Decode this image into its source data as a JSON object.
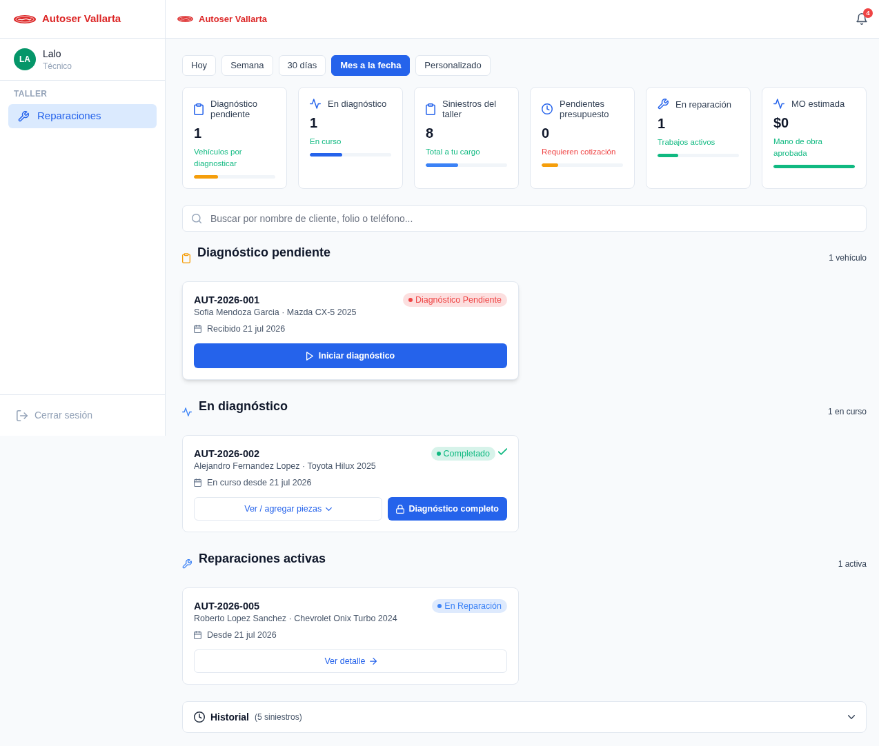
{
  "sidebar": {
    "brand": "Autoser Vallarta",
    "user": {
      "initials": "LA",
      "name": "Lalo",
      "role": "Técnico"
    },
    "sections": [
      {
        "label": "TALLER",
        "items": [
          {
            "label": "Reparaciones",
            "selected": true
          }
        ]
      }
    ],
    "logout": "Cerrar sesión"
  },
  "header": {
    "brand": "Autoser Vallarta",
    "notifications": "4"
  },
  "periods": [
    {
      "label": "Hoy",
      "selected": false
    },
    {
      "label": "Semana",
      "selected": false
    },
    {
      "label": "30 días",
      "selected": false
    },
    {
      "label": "Mes a la fecha",
      "selected": true
    },
    {
      "label": "Personalizado",
      "selected": false
    }
  ],
  "kpis": [
    {
      "kind": "pending",
      "title": "Diagnóstico pendiente",
      "value": "1",
      "note": {
        "text": "Vehículos por diagnosticar",
        "color": "#10b981"
      },
      "bar": {
        "level": 0.3,
        "color": "#f59e0b"
      }
    },
    {
      "kind": "diagnosis",
      "title": "En diagnóstico",
      "value": "1",
      "note": {
        "text": "En curso",
        "color": "#10b981"
      },
      "bar": {
        "level": 0.4,
        "color": "#2563eb"
      }
    },
    {
      "kind": "claims",
      "title": "Siniestros del taller",
      "value": "8",
      "note": {
        "text": "Total a tu cargo",
        "color": "#10b981"
      },
      "bar": {
        "level": 0.4,
        "color": "#3b82f6"
      }
    },
    {
      "kind": "quote",
      "title": "Pendientes presupuesto",
      "value": "0",
      "note": {
        "text": "Requieren cotización",
        "color": "#ef4444"
      },
      "bar": {
        "level": 0.2,
        "color": "#f59e0b"
      }
    },
    {
      "kind": "repair",
      "title": "En reparación",
      "value": "1",
      "note": {
        "text": "Trabajos activos",
        "color": "#10b981"
      },
      "bar": {
        "level": 0.25,
        "color": "#10b981"
      }
    },
    {
      "kind": "labor",
      "title": "MO estimada",
      "value": "$0",
      "note": {
        "text": "Mano de obra aprobada",
        "color": "#10b981"
      },
      "bar": {
        "level": 1,
        "color": "#10b981"
      }
    }
  ],
  "search": {
    "placeholder": "Buscar por nombre de cliente, folio o teléfono..."
  },
  "sections": [
    {
      "kind": "pending",
      "title": "Diagnóstico pendiente",
      "count": "1 vehículo",
      "cards": [
        {
          "folio": "AUT-2026-001",
          "details": "Sofia Mendoza Garcia · Mazda CX-5 2025",
          "date": "Recibido 21 jul 2026",
          "highlighted": true,
          "status": {
            "label": "Diagnóstico Pendiente",
            "color": "#ef4444",
            "checked": false
          },
          "actions": [
            {
              "kind": "start",
              "label": "Iniciar diagnóstico"
            }
          ]
        }
      ]
    },
    {
      "kind": "diagnosis",
      "title": "En diagnóstico",
      "count": "1 en curso",
      "cards": [
        {
          "folio": "AUT-2026-002",
          "details": "Alejandro Fernandez Lopez · Toyota Hilux 2025",
          "date": "En curso desde 21 jul 2026",
          "highlighted": false,
          "status": {
            "label": "Completado",
            "color": "#10b981",
            "checked": true
          },
          "actions": [
            {
              "kind": "expand",
              "label": "Ver / agregar piezas"
            },
            {
              "kind": "lock",
              "label": "Diagnóstico completo"
            }
          ]
        }
      ]
    },
    {
      "kind": "repair",
      "title": "Reparaciones activas",
      "count": "1 activa",
      "cards": [
        {
          "folio": "AUT-2026-005",
          "details": "Roberto Lopez Sanchez · Chevrolet Onix Turbo 2024",
          "date": "Desde 21 jul 2026",
          "highlighted": false,
          "status": {
            "label": "En Reparación",
            "color": "#3b82f6",
            "checked": false
          },
          "actions": [
            {
              "kind": "detail",
              "label": "Ver detalle"
            }
          ]
        }
      ]
    }
  ],
  "history": {
    "title": "Historial",
    "count": "(5 siniestros)",
    "expanded": false
  }
}
